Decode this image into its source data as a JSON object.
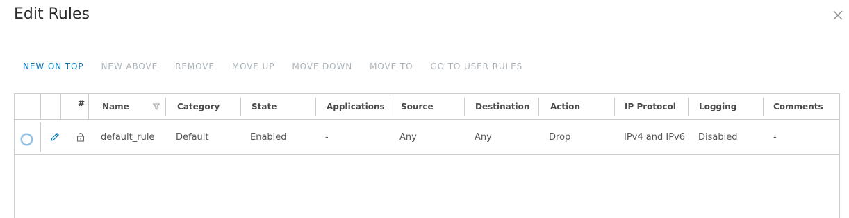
{
  "dialog": {
    "title": "Edit Rules"
  },
  "toolbar": {
    "new_on_top": "NEW ON TOP",
    "new_above": "NEW ABOVE",
    "remove": "REMOVE",
    "move_up": "MOVE UP",
    "move_down": "MOVE DOWN",
    "move_to": "MOVE TO",
    "go_to_user_rules": "GO TO USER RULES"
  },
  "table": {
    "headers": {
      "index": "#",
      "name": "Name",
      "category": "Category",
      "state": "State",
      "applications": "Applications",
      "source": "Source",
      "destination": "Destination",
      "action": "Action",
      "ip_protocol": "IP Protocol",
      "logging": "Logging",
      "comments": "Comments"
    },
    "rows": [
      {
        "name": "default_rule",
        "category": "Default",
        "state": "Enabled",
        "applications": "-",
        "source": "Any",
        "destination": "Any",
        "action": "Drop",
        "ip_protocol": "IPv4 and IPv6",
        "logging": "Disabled",
        "comments": "-"
      }
    ]
  },
  "icons": {
    "close": "close-icon",
    "filter": "filter-icon",
    "edit": "pencil-icon",
    "lock": "lock-icon"
  },
  "colors": {
    "accent": "#0079b8",
    "disabled": "#aab2b8",
    "border": "#cccccc"
  }
}
